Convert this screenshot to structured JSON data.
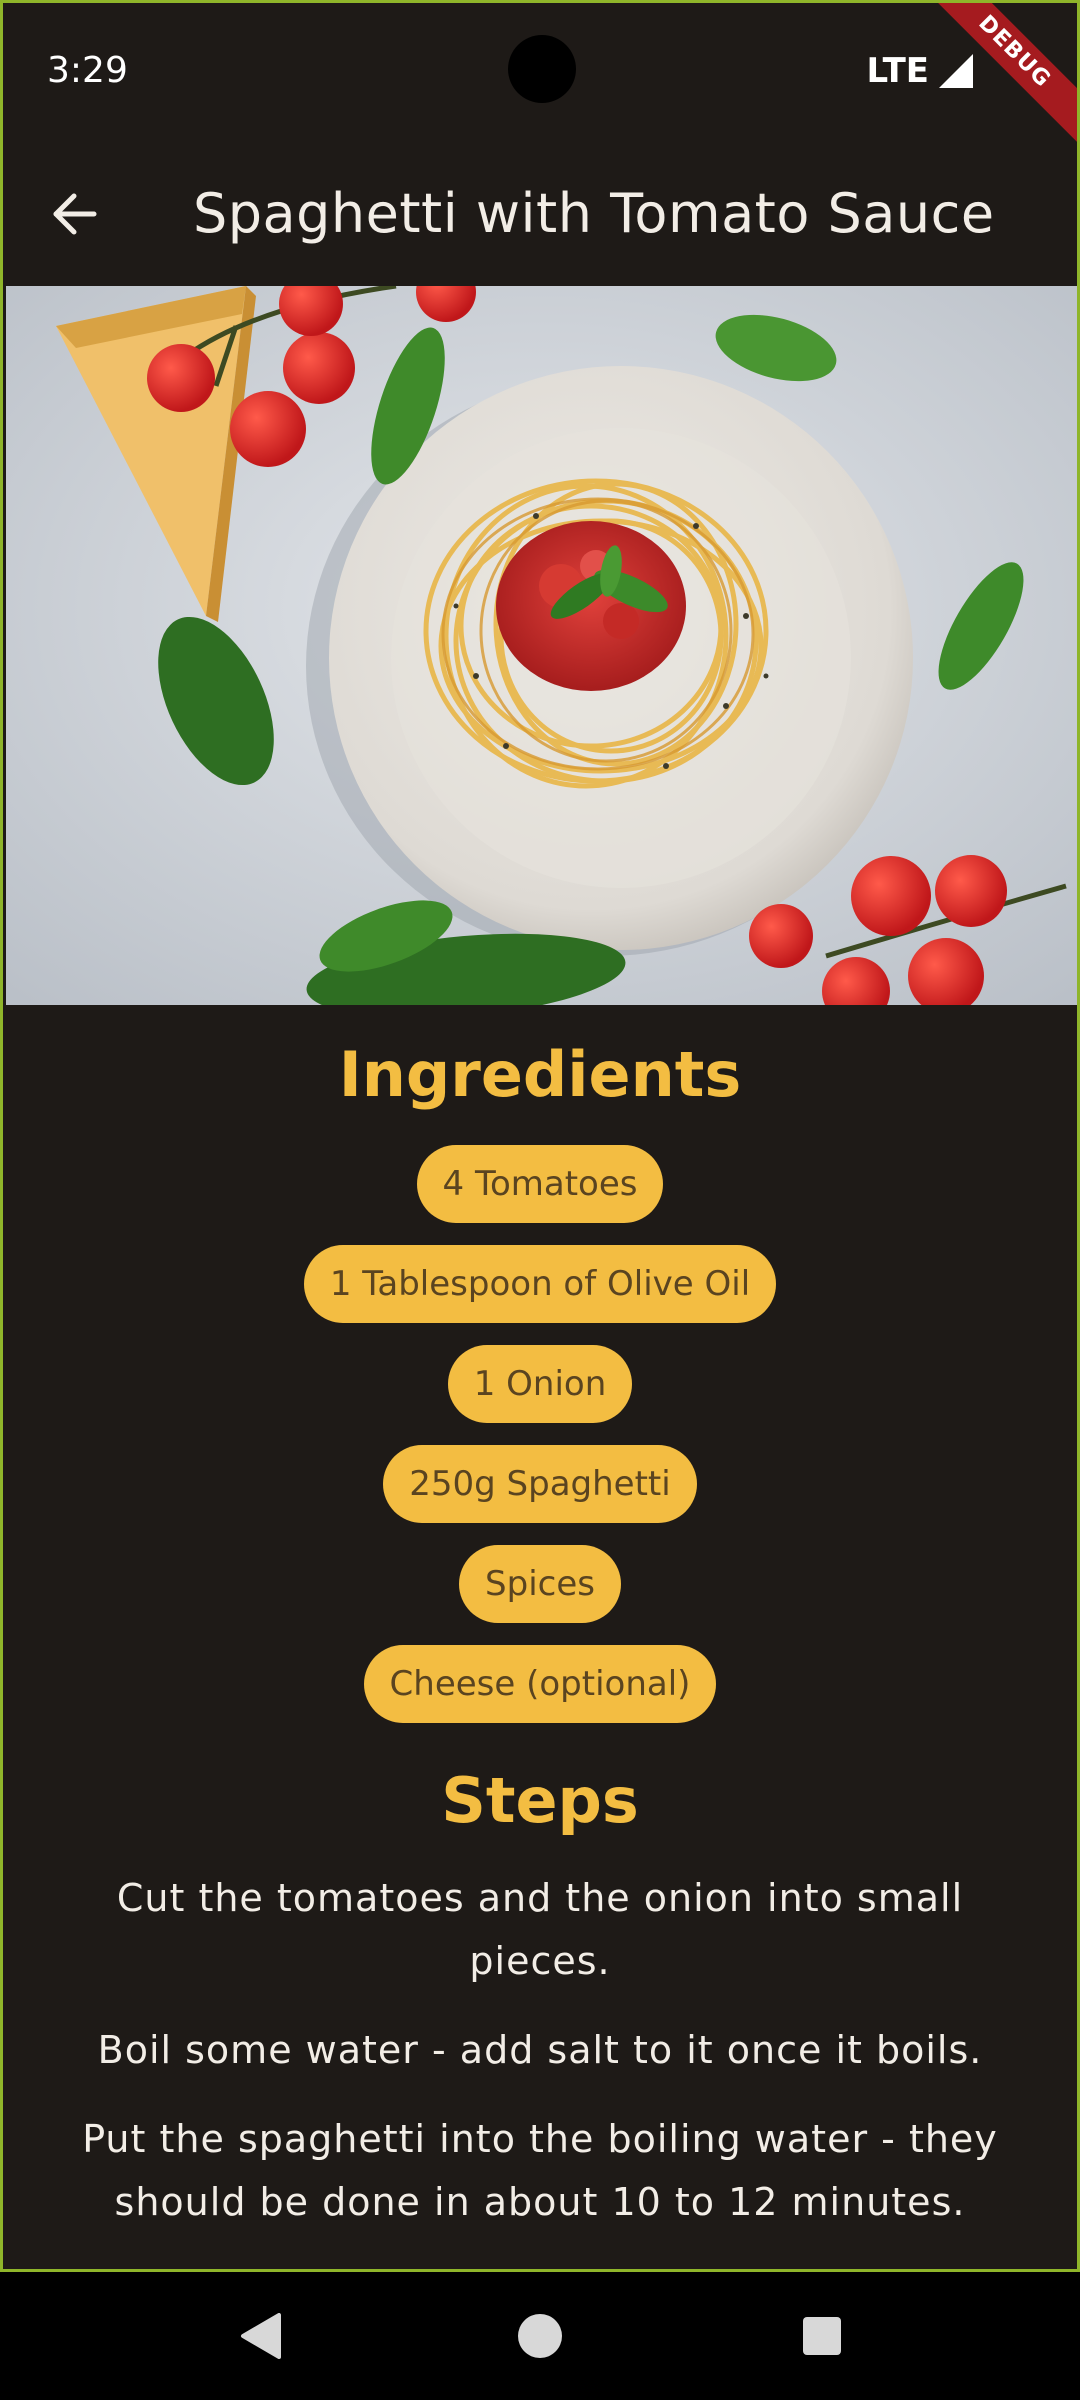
{
  "status_bar": {
    "time": "3:29",
    "network": "LTE",
    "debug_label": "DEBUG"
  },
  "app_bar": {
    "title": "Spaghetti with Tomato Sauce",
    "back_icon": "arrow-back-icon"
  },
  "hero": {
    "image": "spaghetti-with-tomato-sauce-photo"
  },
  "ingredients": {
    "heading": "Ingredients",
    "items": [
      "4 Tomatoes",
      "1 Tablespoon of Olive Oil",
      "1 Onion",
      "250g Spaghetti",
      "Spices",
      "Cheese (optional)"
    ]
  },
  "steps": {
    "heading": "Steps",
    "items": [
      "Cut the tomatoes and the onion into small pieces.",
      "Boil some water - add salt to it once it boils.",
      "Put the spaghetti into the boiling water - they should be done in about 10 to 12 minutes."
    ]
  },
  "nav_bar": {
    "back_icon": "triangle-back-icon",
    "home_icon": "circle-home-icon",
    "recents_icon": "square-recents-icon"
  },
  "colors": {
    "background": "#1e1a17",
    "accent": "#f3bd42",
    "chip_text": "#5a4420",
    "text": "#f2ede6",
    "frame_border": "#8fb52a",
    "debug_ribbon": "#a51b1f"
  }
}
